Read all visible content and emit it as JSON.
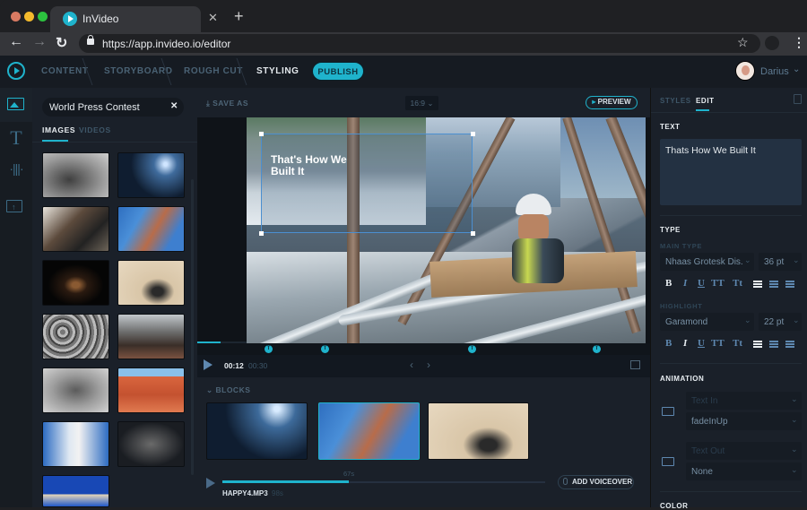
{
  "browser": {
    "tab_title": "InVideo",
    "url": "https://app.invideo.io/editor",
    "traffic_colors": [
      "#d87a62",
      "#f3b92c",
      "#2cc23f"
    ]
  },
  "app": {
    "steps": [
      "CONTENT",
      "STORYBOARD",
      "ROUGH CUT",
      "STYLING"
    ],
    "active_step": "STYLING",
    "publish_label": "PUBLISH",
    "user_name": "Darius",
    "accent": "#1fb3cc"
  },
  "media": {
    "search_value": "World Press Contest",
    "tabs": [
      "IMAGES",
      "VIDEOS"
    ],
    "active_tab": "IMAGES",
    "thumbnails": [
      "fog-grayscale",
      "night-silhouettes",
      "crowd-portrait",
      "blue-city-aerial",
      "night-wildcat",
      "dust-helicopter",
      "bw-crowd",
      "protest-scene",
      "fog-grayscale-2",
      "pink-palace",
      "blue-corridor",
      "dark-group",
      "blue-palace"
    ]
  },
  "stage": {
    "save_as_label": "SAVE AS",
    "ratio": "16:9",
    "preview_label": "PREVIEW",
    "overlay_text": "That's How We Built It",
    "current_time": "00:12",
    "total_time": "00:30",
    "text_marker_label": "T",
    "progress_fraction": 0.4
  },
  "blocks": {
    "label": "BLOCKS",
    "items": [
      "night-silhouettes",
      "blue-city-aerial",
      "dust-helicopter"
    ],
    "selected_index": 1,
    "audio": {
      "file": "HAPPY4.MP3",
      "length": "98s",
      "position": "67s",
      "position_fraction": 0.68
    },
    "voiceover_label": "ADD VOICEOVER"
  },
  "panel": {
    "tabs": [
      "STYLES",
      "EDIT"
    ],
    "active_tab": "EDIT",
    "text_heading": "TEXT",
    "text_value": "Thats How We Built It",
    "type_heading": "TYPE",
    "main_type_label": "MAIN TYPE",
    "main_font": "Nhaas Grotesk Dis.",
    "main_size": "36 pt",
    "highlight_label": "HIGHLIGHT",
    "highlight_font": "Garamond",
    "highlight_size": "22 pt",
    "format_buttons": [
      "B",
      "I",
      "U",
      "TT",
      "Tt"
    ],
    "animation_heading": "ANIMATION",
    "text_in_placeholder": "Text In",
    "text_in_value": "fadeInUp",
    "text_out_placeholder": "Text Out",
    "text_out_value": "None",
    "color_heading": "COLOR"
  }
}
